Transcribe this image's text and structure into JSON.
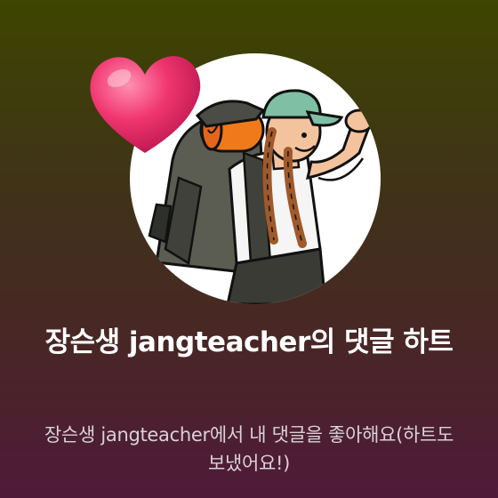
{
  "notification": {
    "title": "장슨생 jangteacher의 댓글 하트",
    "subtitle": "장슨생 jangteacher에서 내 댓글을 좋아해요(하트도 보냈어요!)"
  },
  "avatar": {
    "icon": "hiker-illustration",
    "background": "#ffffff"
  },
  "badge": {
    "icon": "heart-icon",
    "color": "#e8326e"
  }
}
